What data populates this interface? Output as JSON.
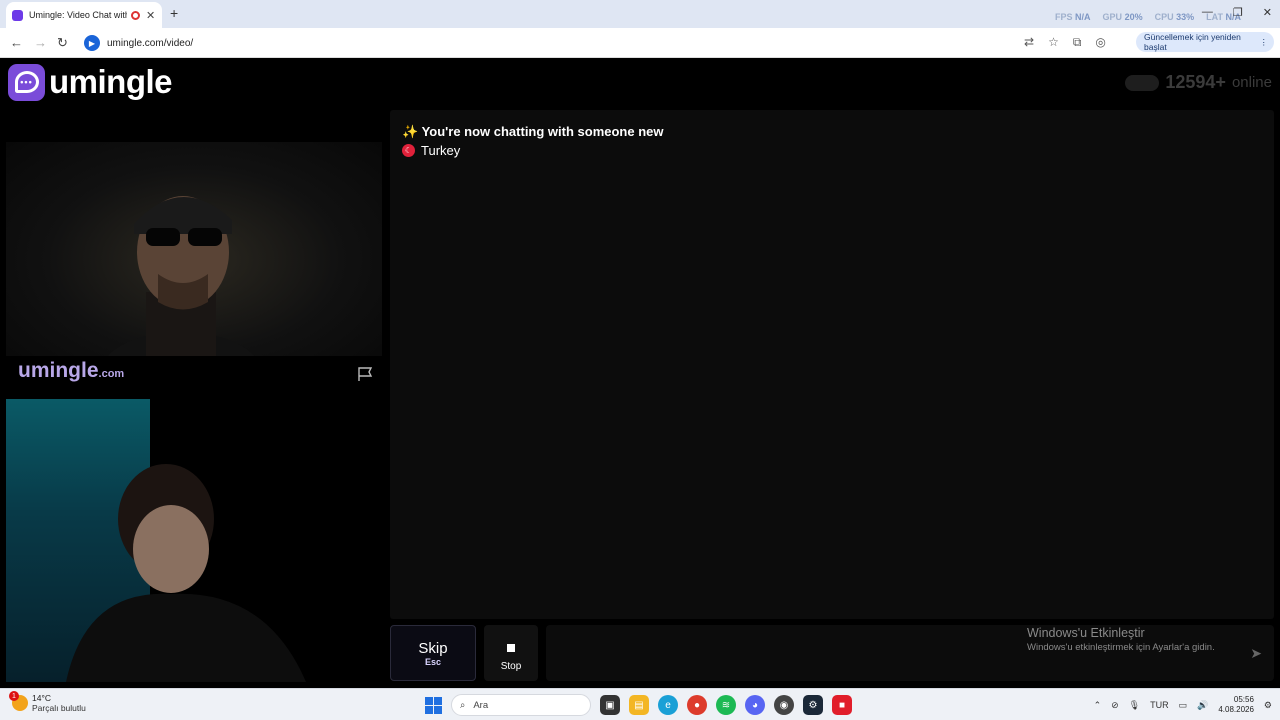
{
  "browser": {
    "tab_title": "Umingle: Video Chat with S",
    "new_tab_glyph": "+",
    "close_glyph": "✕",
    "url": "umingle.com/video/",
    "update_label": "Güncellemek için yeniden başlat",
    "overlay": {
      "fps_label": "FPS",
      "fps_value": "N/A",
      "gpu_label": "GPU",
      "gpu_value": "20%",
      "cpu_label": "CPU",
      "cpu_value": "33%",
      "lat_label": "LAT",
      "lat_value": "N/A"
    }
  },
  "header": {
    "logo_text": "umingle",
    "online_count": "12594+",
    "online_label": "online"
  },
  "video": {
    "watermark_main": "umingle",
    "watermark_suffix": ".com",
    "report_icon": "flag-icon"
  },
  "chat": {
    "sparkle": "✨",
    "status_message": "You're now chatting with someone new",
    "country": "Turkey"
  },
  "controls": {
    "skip_label": "Skip",
    "skip_key": "Esc",
    "stop_label": "Stop",
    "send_icon": "send-icon"
  },
  "activation": {
    "title": "Windows'u Etkinleştir",
    "subtitle": "Windows'u etkinleştirmek için Ayarlar'a gidin."
  },
  "taskbar": {
    "weather_temp": "14°C",
    "weather_condition": "Parçalı bulutlu",
    "weather_badge": "1",
    "search_placeholder": "Ara",
    "language": "TUR",
    "time": "05:56",
    "date": "4.08.2026"
  },
  "colors": {
    "brand": "#7a4cd9",
    "background": "#000000",
    "chat_panel": "#0c0c0c"
  }
}
